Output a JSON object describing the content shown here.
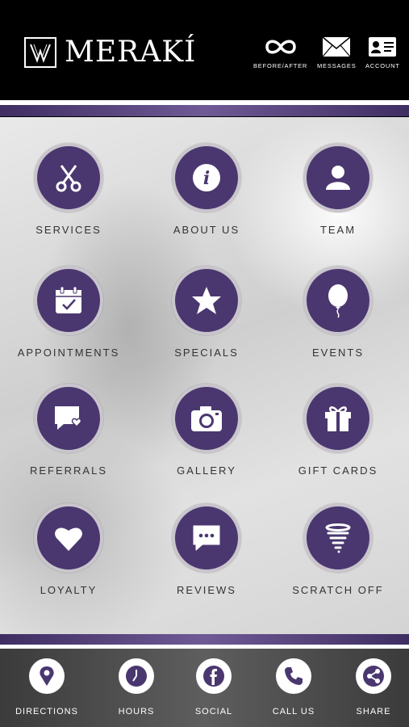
{
  "brand": {
    "name": "MERAKÍ",
    "logo_icon": "meraki-logo-icon"
  },
  "header": {
    "buttons": [
      {
        "label": "BEFORE/AFTER",
        "icon": "infinity-icon"
      },
      {
        "label": "MESSAGES",
        "icon": "envelope-icon"
      },
      {
        "label": "ACCOUNT",
        "icon": "id-card-icon"
      }
    ]
  },
  "tiles": [
    {
      "label": "SERVICES",
      "icon": "scissors-icon"
    },
    {
      "label": "ABOUT US",
      "icon": "info-icon"
    },
    {
      "label": "TEAM",
      "icon": "person-icon"
    },
    {
      "label": "APPOINTMENTS",
      "icon": "calendar-check-icon"
    },
    {
      "label": "SPECIALS",
      "icon": "star-icon"
    },
    {
      "label": "EVENTS",
      "icon": "balloon-icon"
    },
    {
      "label": "REFERRALS",
      "icon": "chat-heart-icon"
    },
    {
      "label": "GALLERY",
      "icon": "camera-icon"
    },
    {
      "label": "GIFT CARDS",
      "icon": "gift-icon"
    },
    {
      "label": "LOYALTY",
      "icon": "heart-icon"
    },
    {
      "label": "REVIEWS",
      "icon": "chat-dots-icon"
    },
    {
      "label": "SCRATCH OFF",
      "icon": "tornado-icon"
    }
  ],
  "footer": {
    "items": [
      {
        "label": "DIRECTIONS",
        "icon": "map-pin-icon"
      },
      {
        "label": "HOURS",
        "icon": "clock-icon"
      },
      {
        "label": "SOCIAL",
        "icon": "facebook-icon"
      },
      {
        "label": "CALL US",
        "icon": "phone-icon"
      },
      {
        "label": "SHARE",
        "icon": "share-icon"
      }
    ]
  },
  "colors": {
    "accent_purple": "#4a376f",
    "header_bg": "#000000",
    "footer_bg": "#4a4a4a"
  }
}
